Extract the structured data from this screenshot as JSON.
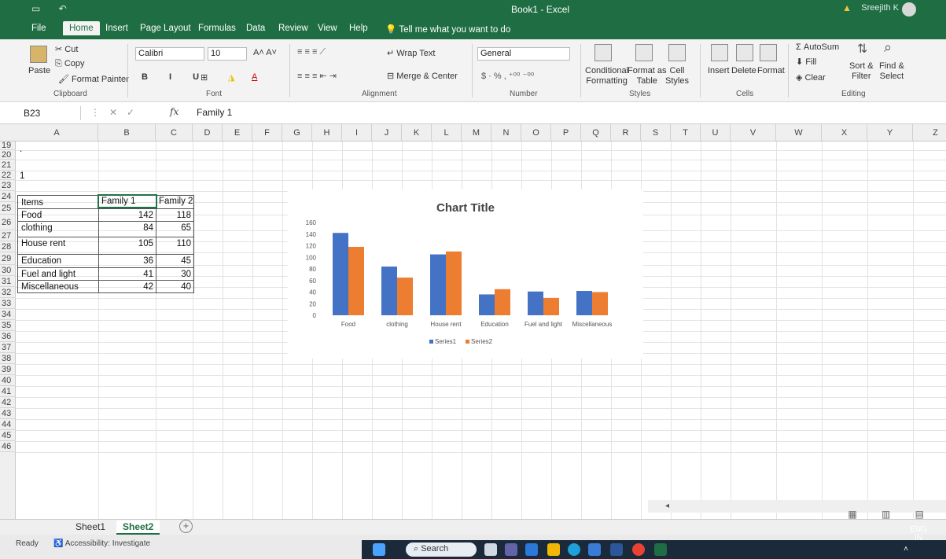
{
  "window": {
    "title": "Book1  -  Excel",
    "user": "Sreejith K"
  },
  "menu": {
    "tabs": [
      "File",
      "Home",
      "Insert",
      "Page Layout",
      "Formulas",
      "Data",
      "Review",
      "View",
      "Help"
    ],
    "active": "Home",
    "tell_me": "Tell me what you want to do"
  },
  "ribbon": {
    "clipboard": {
      "paste": "Paste",
      "cut": "Cut",
      "copy": "Copy",
      "format_painter": "Format Painter",
      "label": "Clipboard"
    },
    "font": {
      "name": "Calibri",
      "size": "10",
      "label": "Font"
    },
    "alignment": {
      "wrap": "Wrap Text",
      "merge": "Merge & Center",
      "label": "Alignment"
    },
    "number": {
      "format": "General",
      "label": "Number"
    },
    "styles": {
      "conditional": "Conditional",
      "formatting": "Formatting",
      "format_as": "Format as",
      "table": "Table",
      "cell": "Cell",
      "cell_styles": "Styles",
      "label": "Styles"
    },
    "cells": {
      "insert": "Insert",
      "delete": "Delete",
      "format": "Format",
      "label": "Cells"
    },
    "editing": {
      "autosum": "AutoSum",
      "fill": "Fill",
      "clear": "Clear",
      "sort": "Sort &",
      "filter": "Filter",
      "find": "Find &",
      "select": "Select",
      "label": "Editing"
    }
  },
  "formula_bar": {
    "name_box": "B23",
    "fx": "fx",
    "value": "Family 1"
  },
  "columns": [
    "A",
    "B",
    "C",
    "D",
    "E",
    "F",
    "G",
    "H",
    "I",
    "J",
    "K",
    "L",
    "M",
    "N",
    "O",
    "P",
    "Q",
    "R",
    "S",
    "T",
    "U",
    "V",
    "W",
    "X",
    "Y",
    "Z"
  ],
  "rows": [
    "19",
    "20",
    "21",
    "22",
    "23",
    "24",
    "25",
    "26",
    "27",
    "28",
    "29",
    "30",
    "31",
    "32",
    "33",
    "34",
    "35",
    "36",
    "37",
    "38",
    "39",
    "40",
    "41",
    "42",
    "43",
    "44",
    "45",
    "46"
  ],
  "cells": {
    "a19": ".",
    "a21": "1",
    "header": {
      "items": "Items",
      "family1": "Family 1",
      "family2": "Family 2"
    },
    "table": [
      {
        "item": "Food",
        "f1": "142",
        "f2": "118"
      },
      {
        "item": "clothing",
        "f1": "84",
        "f2": "65"
      },
      {
        "item": "House rent",
        "f1": "105",
        "f2": "110"
      },
      {
        "item": "Education",
        "f1": "36",
        "f2": "45"
      },
      {
        "item": "Fuel and light",
        "f1": "41",
        "f2": "30"
      },
      {
        "item": "Miscellaneous",
        "f1": "42",
        "f2": "40"
      }
    ]
  },
  "chart_data": {
    "type": "bar",
    "title": "Chart Title",
    "categories": [
      "Food",
      "clothing",
      "House rent",
      "Education",
      "Fuel and light",
      "Miscellaneous"
    ],
    "series": [
      {
        "name": "Series1",
        "values": [
          142,
          84,
          105,
          36,
          41,
          42
        ],
        "color": "#4472c4"
      },
      {
        "name": "Series2",
        "values": [
          118,
          65,
          110,
          45,
          30,
          40
        ],
        "color": "#ed7d31"
      }
    ],
    "yticks": [
      "0",
      "20",
      "40",
      "60",
      "80",
      "100",
      "120",
      "140",
      "160"
    ],
    "ylim": [
      0,
      160
    ],
    "legend": "bottom",
    "grid": false
  },
  "sheets": {
    "tabs": [
      "Sheet1",
      "Sheet2"
    ],
    "active": "Sheet2",
    "add": "+"
  },
  "status": {
    "ready": "Ready",
    "accessibility": "Accessibility: Investigate"
  },
  "taskbar": {
    "search": "Search",
    "lang": "ENG",
    "region": "IN"
  }
}
